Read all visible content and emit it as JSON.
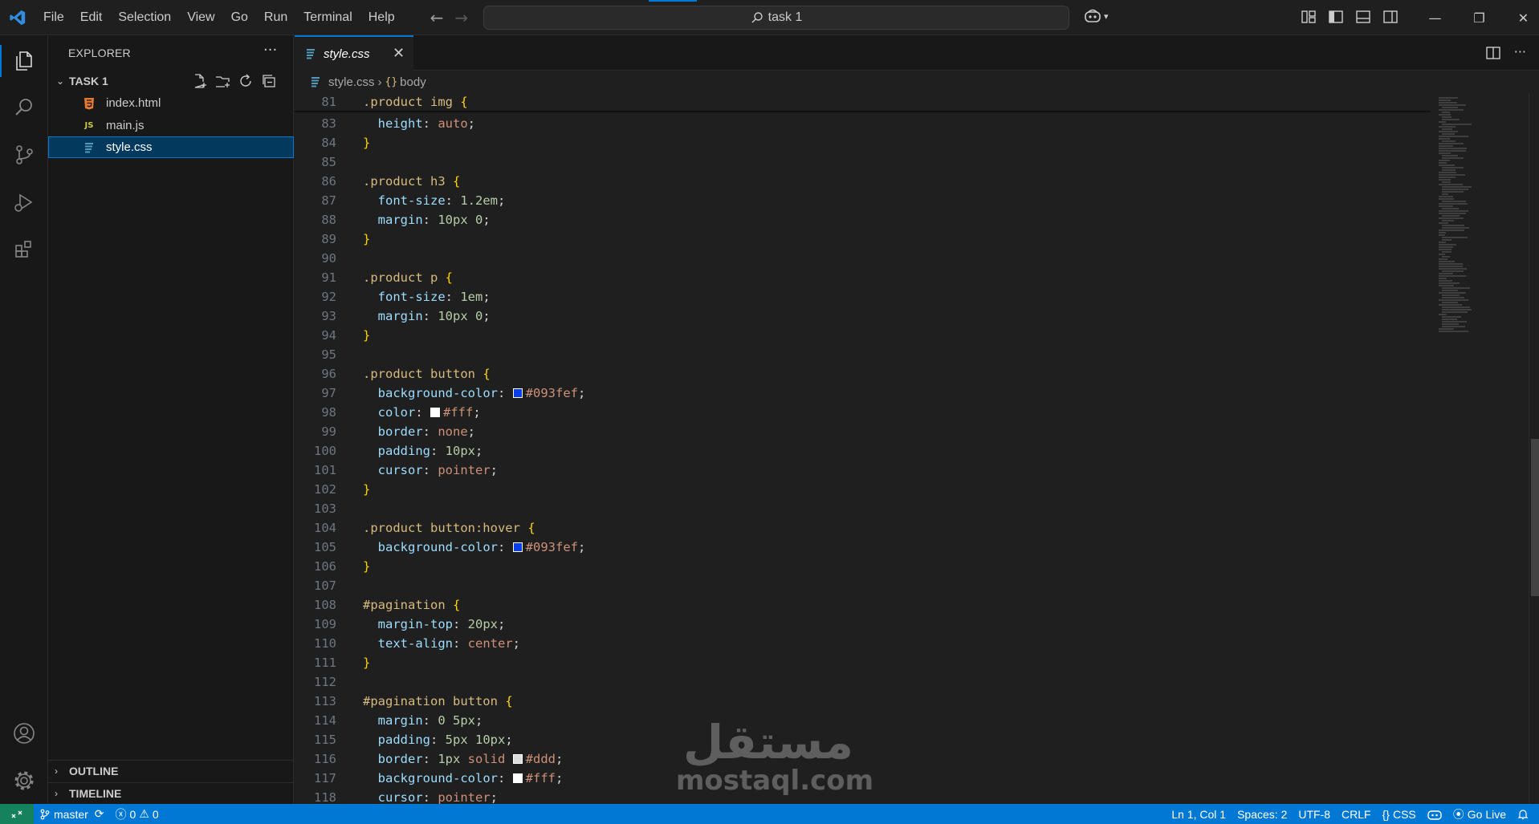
{
  "titlebar": {
    "menus": [
      "File",
      "Edit",
      "Selection",
      "View",
      "Go",
      "Run",
      "Terminal",
      "Help"
    ],
    "search_text": "task 1"
  },
  "sidebar": {
    "title": "EXPLORER",
    "folder": "TASK 1",
    "files": [
      {
        "name": "index.html",
        "icon": "html-file-icon",
        "color": "#e37933"
      },
      {
        "name": "main.js",
        "icon": "js-file-icon",
        "color": "#cbcb41"
      },
      {
        "name": "style.css",
        "icon": "css-file-icon",
        "color": "#519aba",
        "selected": true
      }
    ],
    "outline": "OUTLINE",
    "timeline": "TIMELINE"
  },
  "editor": {
    "tab_label": "style.css",
    "breadcrumb": [
      "style.css",
      "body"
    ],
    "lines": [
      {
        "n": "81",
        "tokens": [
          [
            "sel",
            ".product img "
          ],
          [
            "brace",
            "{"
          ]
        ]
      },
      {
        "n": "83",
        "tokens": [
          [
            "sp",
            "  "
          ],
          [
            "prop",
            "height"
          ],
          [
            "punc",
            ": "
          ],
          [
            "val",
            "auto"
          ],
          [
            "punc",
            ";"
          ]
        ]
      },
      {
        "n": "84",
        "tokens": [
          [
            "brace",
            "}"
          ]
        ]
      },
      {
        "n": "85",
        "tokens": []
      },
      {
        "n": "86",
        "tokens": [
          [
            "sel",
            ".product h3 "
          ],
          [
            "brace",
            "{"
          ]
        ]
      },
      {
        "n": "87",
        "tokens": [
          [
            "sp",
            "  "
          ],
          [
            "prop",
            "font-size"
          ],
          [
            "punc",
            ": "
          ],
          [
            "num",
            "1.2em"
          ],
          [
            "punc",
            ";"
          ]
        ]
      },
      {
        "n": "88",
        "tokens": [
          [
            "sp",
            "  "
          ],
          [
            "prop",
            "margin"
          ],
          [
            "punc",
            ": "
          ],
          [
            "num",
            "10px 0"
          ],
          [
            "punc",
            ";"
          ]
        ]
      },
      {
        "n": "89",
        "tokens": [
          [
            "brace",
            "}"
          ]
        ]
      },
      {
        "n": "90",
        "tokens": []
      },
      {
        "n": "91",
        "tokens": [
          [
            "sel",
            ".product p "
          ],
          [
            "brace",
            "{"
          ]
        ]
      },
      {
        "n": "92",
        "tokens": [
          [
            "sp",
            "  "
          ],
          [
            "prop",
            "font-size"
          ],
          [
            "punc",
            ": "
          ],
          [
            "num",
            "1em"
          ],
          [
            "punc",
            ";"
          ]
        ]
      },
      {
        "n": "93",
        "tokens": [
          [
            "sp",
            "  "
          ],
          [
            "prop",
            "margin"
          ],
          [
            "punc",
            ": "
          ],
          [
            "num",
            "10px 0"
          ],
          [
            "punc",
            ";"
          ]
        ]
      },
      {
        "n": "94",
        "tokens": [
          [
            "brace",
            "}"
          ]
        ]
      },
      {
        "n": "95",
        "tokens": []
      },
      {
        "n": "96",
        "tokens": [
          [
            "sel",
            ".product button "
          ],
          [
            "brace",
            "{"
          ]
        ]
      },
      {
        "n": "97",
        "tokens": [
          [
            "sp",
            "  "
          ],
          [
            "prop",
            "background-color"
          ],
          [
            "punc",
            ": "
          ],
          [
            "swatch",
            "#093fef"
          ],
          [
            "val",
            "#093fef"
          ],
          [
            "punc",
            ";"
          ]
        ]
      },
      {
        "n": "98",
        "tokens": [
          [
            "sp",
            "  "
          ],
          [
            "prop",
            "color"
          ],
          [
            "punc",
            ": "
          ],
          [
            "swatch",
            "#ffffff"
          ],
          [
            "val",
            "#fff"
          ],
          [
            "punc",
            ";"
          ]
        ]
      },
      {
        "n": "99",
        "tokens": [
          [
            "sp",
            "  "
          ],
          [
            "prop",
            "border"
          ],
          [
            "punc",
            ": "
          ],
          [
            "val",
            "none"
          ],
          [
            "punc",
            ";"
          ]
        ]
      },
      {
        "n": "100",
        "tokens": [
          [
            "sp",
            "  "
          ],
          [
            "prop",
            "padding"
          ],
          [
            "punc",
            ": "
          ],
          [
            "num",
            "10px"
          ],
          [
            "punc",
            ";"
          ]
        ]
      },
      {
        "n": "101",
        "tokens": [
          [
            "sp",
            "  "
          ],
          [
            "prop",
            "cursor"
          ],
          [
            "punc",
            ": "
          ],
          [
            "val",
            "pointer"
          ],
          [
            "punc",
            ";"
          ]
        ]
      },
      {
        "n": "102",
        "tokens": [
          [
            "brace",
            "}"
          ]
        ]
      },
      {
        "n": "103",
        "tokens": []
      },
      {
        "n": "104",
        "tokens": [
          [
            "sel",
            ".product button:hover "
          ],
          [
            "brace",
            "{"
          ]
        ]
      },
      {
        "n": "105",
        "tokens": [
          [
            "sp",
            "  "
          ],
          [
            "prop",
            "background-color"
          ],
          [
            "punc",
            ": "
          ],
          [
            "swatch",
            "#093fef"
          ],
          [
            "val",
            "#093fef"
          ],
          [
            "punc",
            ";"
          ]
        ]
      },
      {
        "n": "106",
        "tokens": [
          [
            "brace",
            "}"
          ]
        ]
      },
      {
        "n": "107",
        "tokens": []
      },
      {
        "n": "108",
        "tokens": [
          [
            "sel",
            "#pagination "
          ],
          [
            "brace",
            "{"
          ]
        ]
      },
      {
        "n": "109",
        "tokens": [
          [
            "sp",
            "  "
          ],
          [
            "prop",
            "margin-top"
          ],
          [
            "punc",
            ": "
          ],
          [
            "num",
            "20px"
          ],
          [
            "punc",
            ";"
          ]
        ]
      },
      {
        "n": "110",
        "tokens": [
          [
            "sp",
            "  "
          ],
          [
            "prop",
            "text-align"
          ],
          [
            "punc",
            ": "
          ],
          [
            "val",
            "center"
          ],
          [
            "punc",
            ";"
          ]
        ]
      },
      {
        "n": "111",
        "tokens": [
          [
            "brace",
            "}"
          ]
        ]
      },
      {
        "n": "112",
        "tokens": []
      },
      {
        "n": "113",
        "tokens": [
          [
            "sel",
            "#pagination button "
          ],
          [
            "brace",
            "{"
          ]
        ]
      },
      {
        "n": "114",
        "tokens": [
          [
            "sp",
            "  "
          ],
          [
            "prop",
            "margin"
          ],
          [
            "punc",
            ": "
          ],
          [
            "num",
            "0 5px"
          ],
          [
            "punc",
            ";"
          ]
        ]
      },
      {
        "n": "115",
        "tokens": [
          [
            "sp",
            "  "
          ],
          [
            "prop",
            "padding"
          ],
          [
            "punc",
            ": "
          ],
          [
            "num",
            "5px 10px"
          ],
          [
            "punc",
            ";"
          ]
        ]
      },
      {
        "n": "116",
        "tokens": [
          [
            "sp",
            "  "
          ],
          [
            "prop",
            "border"
          ],
          [
            "punc",
            ": "
          ],
          [
            "num",
            "1px "
          ],
          [
            "val",
            "solid "
          ],
          [
            "swatch",
            "#dddddd"
          ],
          [
            "val",
            "#ddd"
          ],
          [
            "punc",
            ";"
          ]
        ]
      },
      {
        "n": "117",
        "tokens": [
          [
            "sp",
            "  "
          ],
          [
            "prop",
            "background-color"
          ],
          [
            "punc",
            ": "
          ],
          [
            "swatch",
            "#ffffff"
          ],
          [
            "val",
            "#fff"
          ],
          [
            "punc",
            ";"
          ]
        ]
      },
      {
        "n": "118",
        "tokens": [
          [
            "sp",
            "  "
          ],
          [
            "prop",
            "cursor"
          ],
          [
            "punc",
            ": "
          ],
          [
            "val",
            "pointer"
          ],
          [
            "punc",
            ";"
          ]
        ]
      }
    ]
  },
  "watermark": {
    "arabic": "مستقل",
    "latin": "mostaql.com"
  },
  "statusbar": {
    "branch": "master",
    "errors": "0",
    "warnings": "0",
    "position": "Ln 1, Col 1",
    "spaces": "Spaces: 2",
    "encoding": "UTF-8",
    "eol": "CRLF",
    "language": "CSS",
    "golive": "Go Live"
  },
  "colors": {
    "accent": "#0078d4",
    "statusbar": "#0078d4",
    "remote": "#16825d"
  }
}
